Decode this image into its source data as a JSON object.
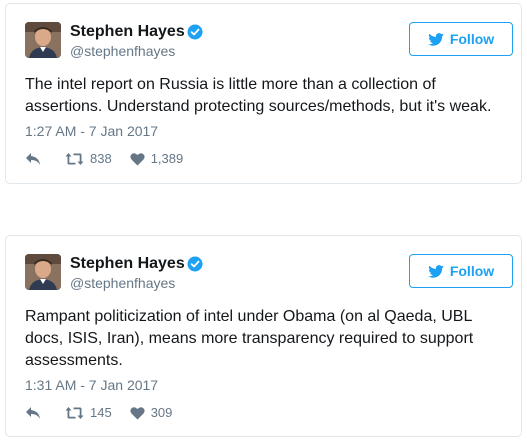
{
  "tweets": [
    {
      "author": {
        "display_name": "Stephen Hayes",
        "handle": "@stephenfhayes",
        "verified": true,
        "avatar": "profile-photo"
      },
      "follow_label": "Follow",
      "text": "The intel report on Russia is little more than a collection of assertions. Understand protecting sources/methods, but it's weak.",
      "timestamp": "1:27 AM - 7 Jan 2017",
      "reply_icon": "reply-arrow-icon",
      "retweets": "838",
      "likes": "1,389"
    },
    {
      "author": {
        "display_name": "Stephen Hayes",
        "handle": "@stephenfhayes",
        "verified": true,
        "avatar": "profile-photo"
      },
      "follow_label": "Follow",
      "text": "Rampant politicization of intel under Obama (on al Qaeda, UBL docs, ISIS, Iran), means more transparency required to support assessments.",
      "timestamp": "1:31 AM - 7 Jan 2017",
      "reply_icon": "reply-arrow-icon",
      "retweets": "145",
      "likes": "309"
    }
  ],
  "colors": {
    "twitter_blue": "#1da1f2",
    "text": "#14171a",
    "secondary_text": "#657786",
    "border": "#e1e8ed"
  }
}
